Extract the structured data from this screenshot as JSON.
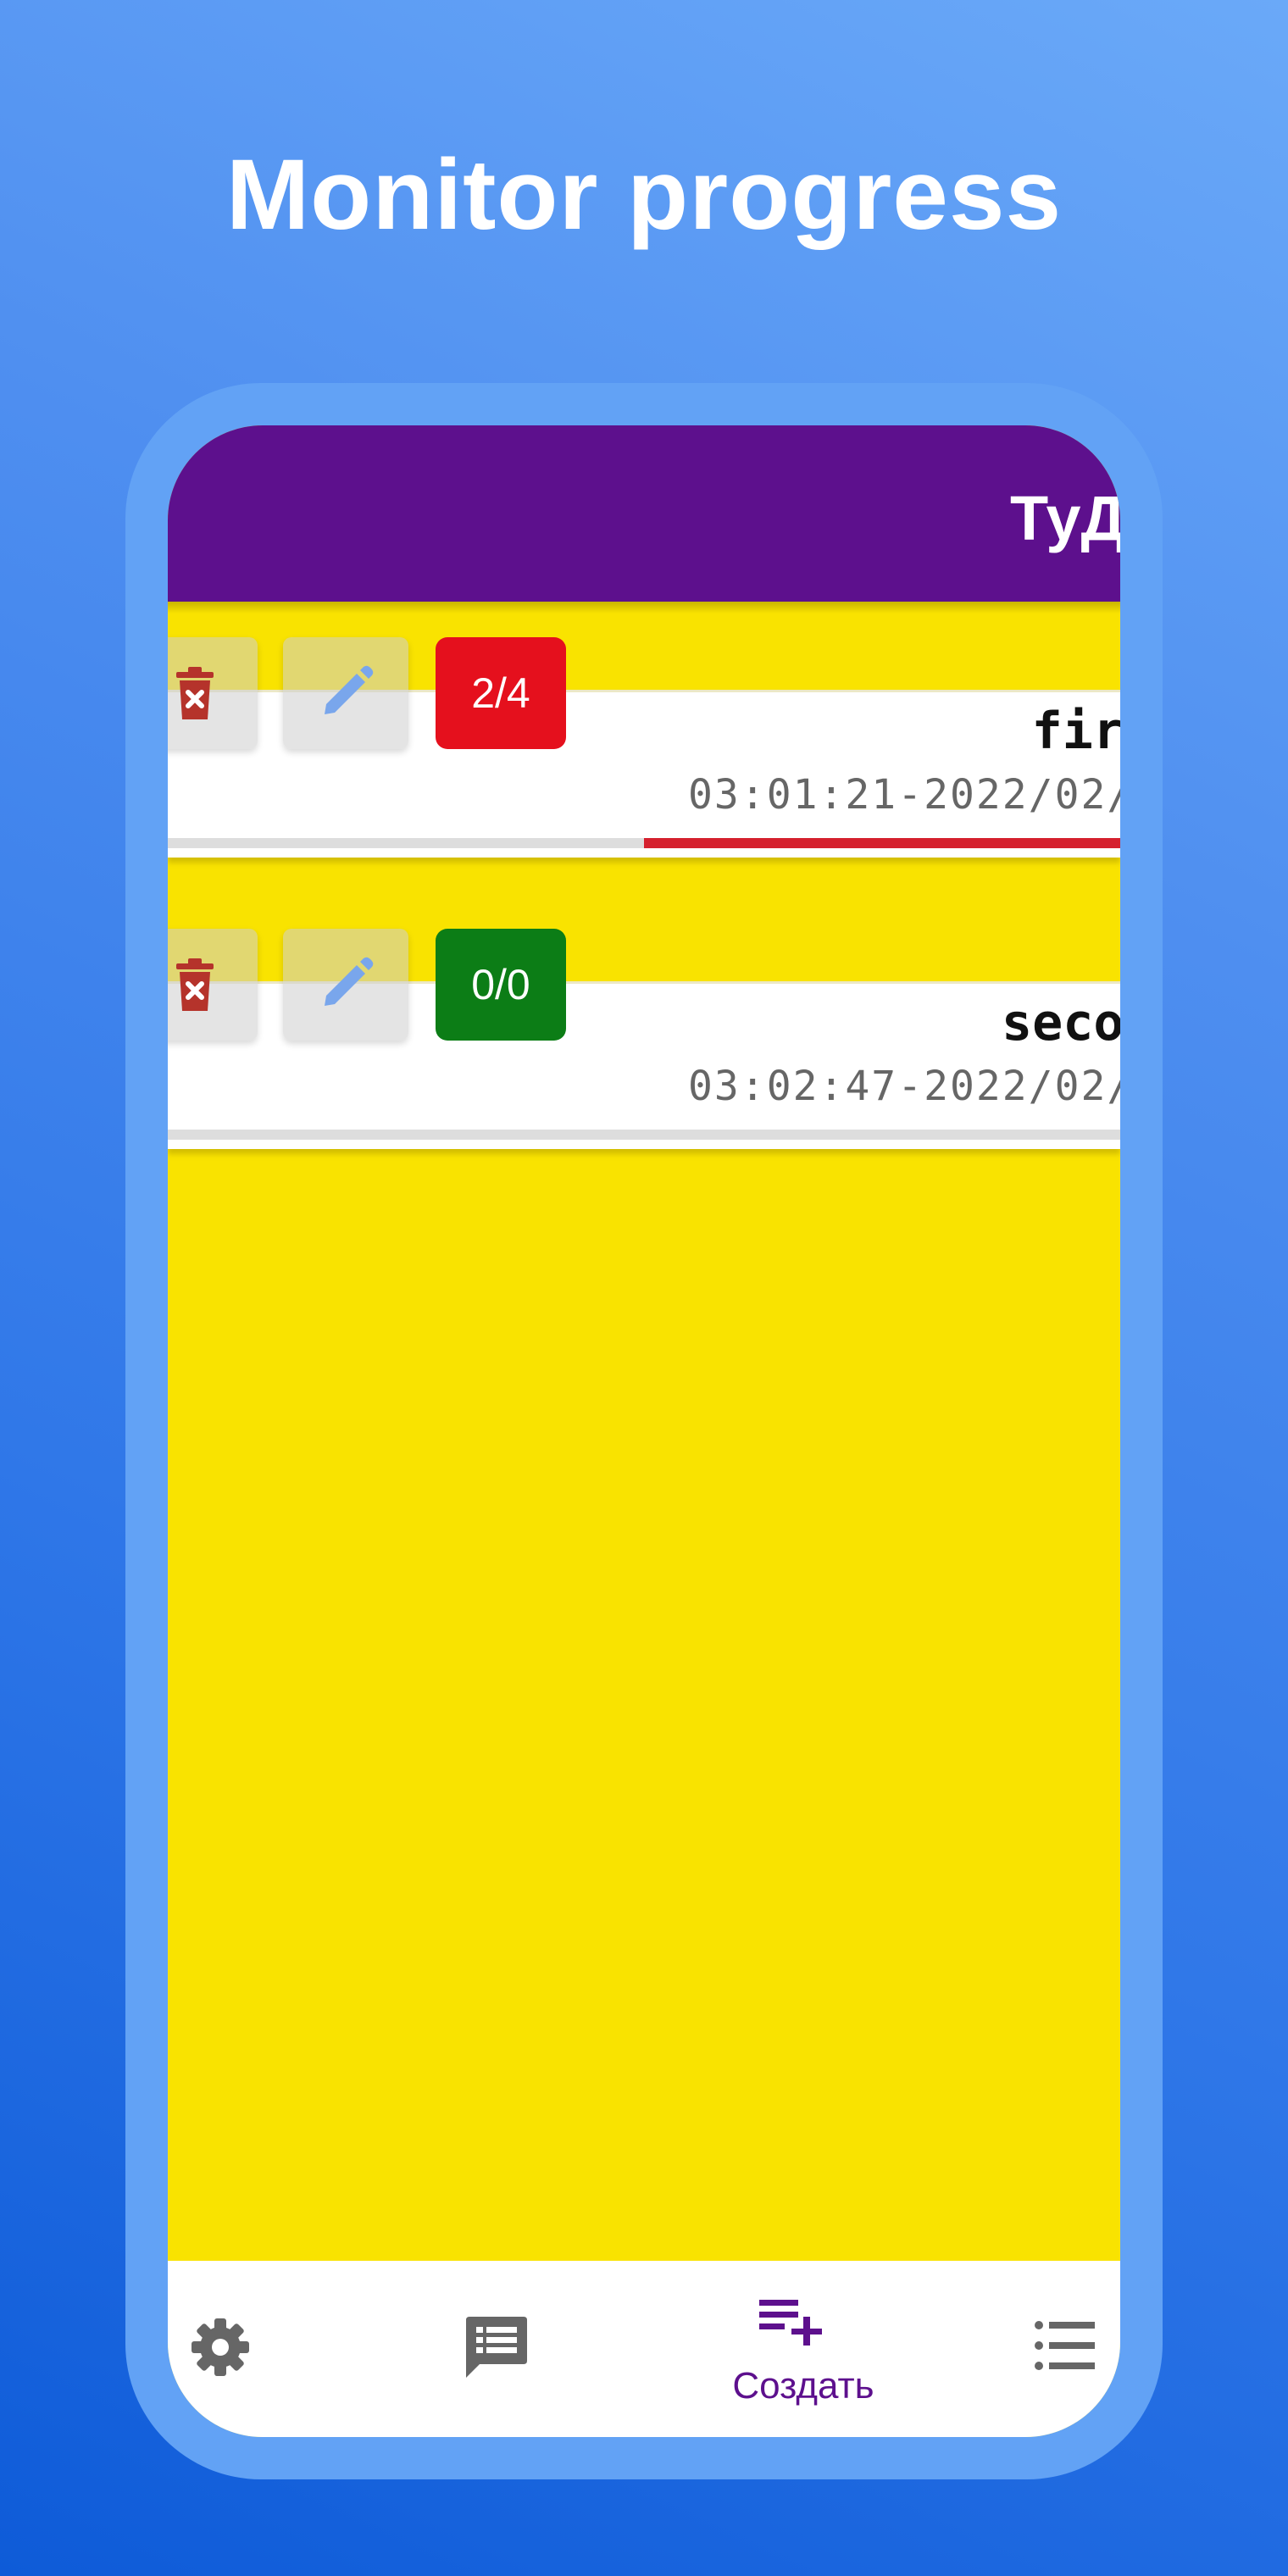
{
  "headline": "Monitor progress",
  "app_bar": {
    "title": "ТуД"
  },
  "tasks": [
    {
      "title": "fir",
      "date": "03:01:21-2022/02/",
      "counter": "2/4",
      "counter_color": "#e5101d",
      "progress": 0.5
    },
    {
      "title": "seco",
      "date": "03:02:47-2022/02/",
      "counter": "0/0",
      "counter_color": "#0c7d16",
      "progress": 0
    }
  ],
  "bottom_nav": {
    "items": [
      {
        "icon": "gear-icon",
        "label": ""
      },
      {
        "icon": "message-icon",
        "label": ""
      },
      {
        "icon": "add-list-icon",
        "label": "Создать",
        "active": true
      },
      {
        "icon": "list-icon",
        "label": ""
      }
    ]
  },
  "colors": {
    "background": "#3d82ec",
    "app_bar": "#5d108d",
    "content_background": "#f9e300",
    "progress_fill": "#d5202e",
    "delete_icon": "#b5332b",
    "edit_icon": "#79a6ec",
    "nav_active": "#5d108d",
    "nav_inactive": "#666666"
  }
}
